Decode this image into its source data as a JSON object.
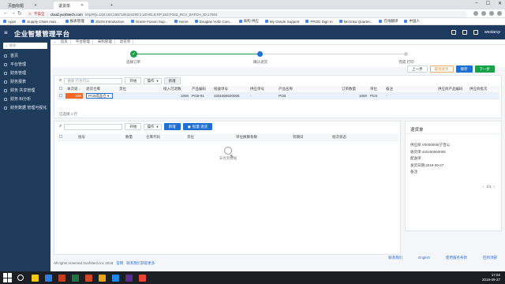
{
  "browser": {
    "tabs": [
      {
        "label": "页面标题"
      },
      {
        "label": "退货单"
      }
    ],
    "insecure_label": "不安全",
    "url_domain": "cloud.yunhitech.com",
    "url_rest": "/erp/#/p=100;162;1557166324499;1;LEVEL8;RP;163;P163_RCV_BATCH_ID;17694",
    "bookmarks": [
      "Apps",
      "Supply Chain man...",
      "报表管理",
      "JSON Introduction",
      "Oracle Fusion Sup...",
      "Home",
      "Douglas Voltz Com...",
      "采购 供应",
      "My Oracle Support",
      "PROD Sign In",
      "McGraw Quarter...",
      "在线翻译",
      "中国人"
    ]
  },
  "app": {
    "title": "企业智慧管理平台",
    "user_label": "westarcp"
  },
  "sidebar": {
    "search_placeholder": "搜索",
    "items": [
      {
        "label": "首页"
      },
      {
        "label": "平台管理"
      },
      {
        "label": "财务管理"
      },
      {
        "label": "财务报表"
      },
      {
        "label": "财务 共享管理"
      },
      {
        "label": "财务 BI分析"
      },
      {
        "label": "财务数据 管理可视化"
      }
    ]
  },
  "breadcrumb": {
    "items": [
      "首页",
      "平台管理",
      "采购管理",
      "退货单"
    ]
  },
  "steps": {
    "items": [
      {
        "label": "选择订单",
        "state": "done"
      },
      {
        "label": "确认退货",
        "state": "current"
      },
      {
        "label": "完成 打印",
        "state": "todo"
      }
    ]
  },
  "actions": {
    "prev": "上一步",
    "cancel": "取消退货",
    "save": "保存",
    "next": "下一步"
  },
  "upper_table": {
    "search_placeholder": "搜索 行也可以",
    "filter_btn": "开始",
    "op_dropdown": "操作",
    "add_btn": "新增",
    "columns": [
      "本次退...",
      "退货仓库",
      "货位",
      "接入可退数",
      "产品编码",
      "接收单号",
      "供应单号",
      "产品名称",
      "订单数量",
      "单位",
      "备注",
      "供应商产品编码",
      "供应商批次"
    ],
    "rows": [
      {
        "qty": "100",
        "warehouse": "PCB成品仓",
        "location": "",
        "avail": "1000",
        "code": "PCB-01",
        "receipt": "4201906020005",
        "supply": "-",
        "name": "PCB",
        "order_qty": "1000",
        "unit": "PCS",
        "remark": "-",
        "vendor_code": "",
        "vendor_batch": ""
      }
    ],
    "selected_info": "已选择 1 行"
  },
  "lower_table": {
    "search_placeholder": "",
    "filter_btn": "开始",
    "op_dropdown": "操作",
    "add_btn": "新增",
    "batch_btn": "批量 退货",
    "columns": [
      "批号",
      "数量",
      "仓库代码",
      "货位",
      "单位换算系数",
      "到期日",
      "批次状态"
    ],
    "empty_text": "未找到数据"
  },
  "summary": {
    "title": "退货单",
    "lines": [
      "供应商:V0000000(宁百公",
      "收货单:420190060005",
      "配送单:",
      "发货日期:2019-09-27",
      "备注:"
    ],
    "pager": "1/1"
  },
  "footer": {
    "copyright": "All rights reserved.Yunhitech.inc 2018",
    "link1": "官网",
    "link2": "联系我们获取更多",
    "links_right": [
      "联系我们",
      "English",
      "使用服务条款",
      "回到顶部"
    ]
  },
  "taskbar": {
    "time": "17:02",
    "date": "2019-09-27",
    "app_colors": [
      "#f2c811",
      "#2f7de1",
      "#c43e1c",
      "#217346",
      "#d24726",
      "#e8a317",
      "#1e88e5",
      "#5c2d91",
      "#ea4335"
    ]
  }
}
